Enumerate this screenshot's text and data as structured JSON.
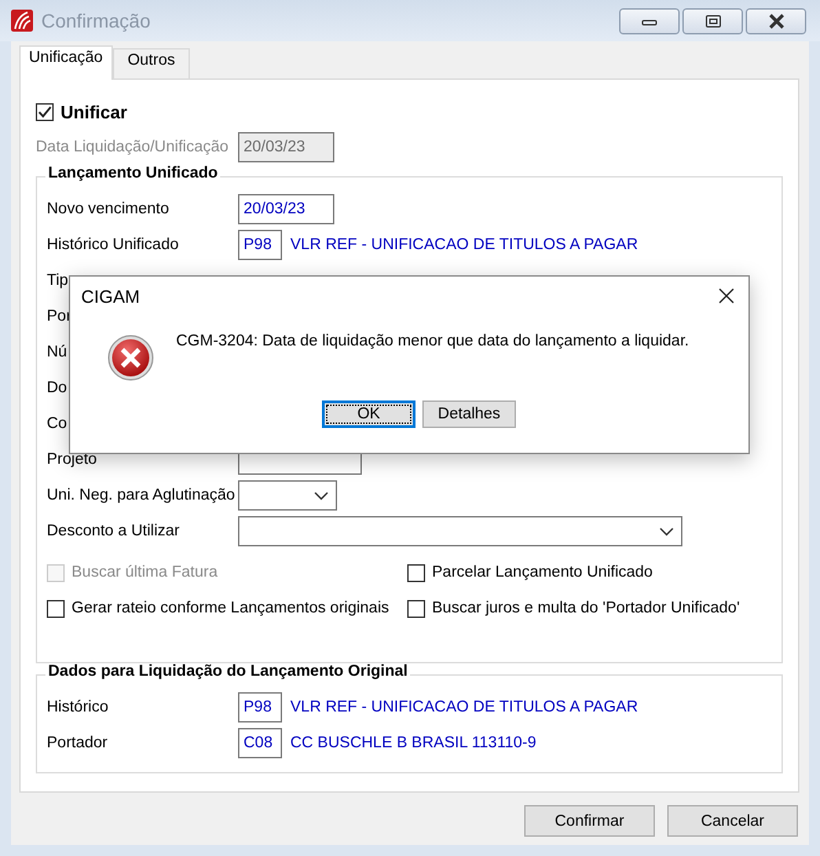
{
  "window": {
    "title": "Confirmação"
  },
  "tabs": [
    {
      "label": "Unificação",
      "selected": true
    },
    {
      "label": "Outros",
      "selected": false
    }
  ],
  "unificar": {
    "label": "Unificar",
    "checked": true
  },
  "data_liquidacao": {
    "label": "Data Liquidação/Unificação",
    "value": "20/03/23",
    "disabled": true
  },
  "lancamento_unificado": {
    "title": "Lançamento Unificado",
    "rows": [
      {
        "kind": "date",
        "label": "Novo vencimento",
        "value": "20/03/23"
      },
      {
        "kind": "code",
        "label": "Histórico Unificado",
        "code": "P98",
        "description": "VLR REF - UNIFICACAO DE TITULOS A PAGAR"
      },
      {
        "kind": "covered",
        "label": "Tip"
      },
      {
        "kind": "covered",
        "label": "Por"
      },
      {
        "kind": "covered",
        "label": "Nú"
      },
      {
        "kind": "covered",
        "label": "Do"
      },
      {
        "kind": "covered",
        "label": "Co"
      },
      {
        "kind": "empty",
        "label": "Projeto"
      },
      {
        "kind": "combo",
        "label": "Uni. Neg. para Aglutinação"
      },
      {
        "kind": "combo-wide",
        "label": "Desconto a Utilizar"
      }
    ],
    "checkboxes": [
      {
        "label": "Buscar última Fatura",
        "checked": false,
        "disabled": true
      },
      {
        "label": "Parcelar Lançamento Unificado",
        "checked": false,
        "disabled": false
      },
      {
        "label": "Gerar rateio conforme Lançamentos originais",
        "checked": false,
        "disabled": false
      },
      {
        "label": "Buscar juros e multa do 'Portador Unificado'",
        "checked": false,
        "disabled": false
      }
    ]
  },
  "dados_liquidacao": {
    "title": "Dados para Liquidação do Lançamento Original",
    "rows": [
      {
        "kind": "code",
        "label": "Histórico",
        "code": "P98",
        "description": "VLR REF - UNIFICACAO DE TITULOS A PAGAR"
      },
      {
        "kind": "code",
        "label": "Portador",
        "code": "C08",
        "description": "CC BUSCHLE B BRASIL 113110-9"
      }
    ]
  },
  "buttons": [
    {
      "label": "Confirmar"
    },
    {
      "label": "Cancelar"
    }
  ],
  "dialog": {
    "title": "CIGAM",
    "message": "CGM-3204: Data de liquidação menor que data do lançamento a liquidar.",
    "buttons": [
      {
        "label": "OK",
        "selected": true
      },
      {
        "label": "Detalhes",
        "selected": false
      }
    ]
  }
}
